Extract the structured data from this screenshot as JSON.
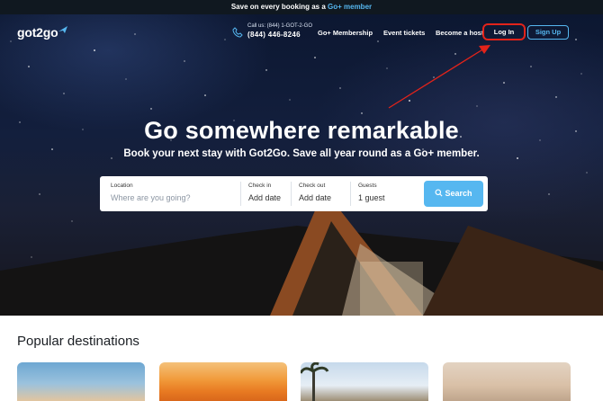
{
  "promo_bar": {
    "text": "Save on every booking as a ",
    "link": "Go+ member"
  },
  "brand": {
    "logo_text": "got2go"
  },
  "nav": {
    "phone_caption": "Call us: (844) 1-GOT-2-GO",
    "phone_number": "(844) 446-8246",
    "links": [
      "Go+ Membership",
      "Event tickets",
      "Become a host"
    ],
    "login_label": "Log In",
    "signup_label": "Sign Up"
  },
  "hero": {
    "title": "Go somewhere remarkable",
    "subtitle": "Book your next stay with Got2Go. Save all year round as a Go+ member."
  },
  "search": {
    "location_label": "Location",
    "location_placeholder": "Where are you going?",
    "checkin_label": "Check in",
    "checkin_value": "Add date",
    "checkout_label": "Check out",
    "checkout_value": "Add date",
    "guests_label": "Guests",
    "guests_value": "1 guest",
    "button_label": "Search"
  },
  "popular": {
    "heading": "Popular destinations",
    "card_count_visible": 4
  },
  "colors": {
    "accent": "#56b7f0",
    "highlight": "#e2231a",
    "topbar": "#101820"
  },
  "icons": [
    "plane-icon",
    "phone-icon",
    "search-icon"
  ]
}
